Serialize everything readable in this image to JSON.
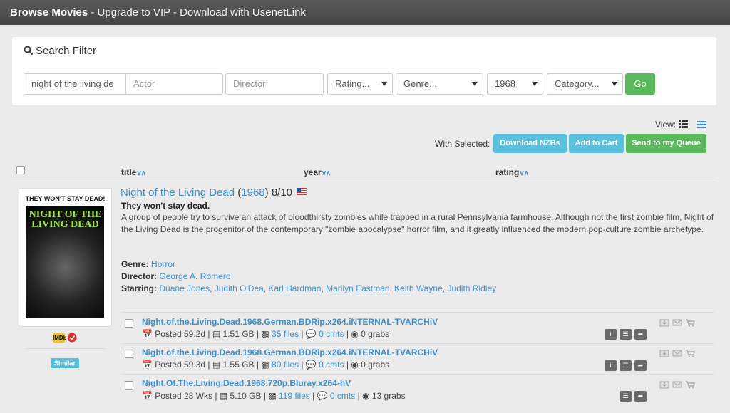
{
  "header": {
    "title": "Browse Movies",
    "subtitle": " - Upgrade to VIP - Download with UsenetLink"
  },
  "filter": {
    "title": "Search Filter",
    "title_value": "night of the living de",
    "actor_placeholder": "Actor",
    "director_placeholder": "Director",
    "rating": "Rating...",
    "genre": "Genre...",
    "year": "1968",
    "category": "Category...",
    "go_label": "Go"
  },
  "toolbar": {
    "view_label": "View:",
    "with_selected": "With Selected:",
    "download_nzbs": "Download NZBs",
    "add_to_cart": "Add to Cart",
    "send_to_queue": "Send to my Queue"
  },
  "columns": {
    "title": "title",
    "year": "year",
    "rating": "rating"
  },
  "movie": {
    "title": "Night of the Living Dead",
    "year": "1968",
    "rating": "8/10",
    "tagline": "They won't stay dead.",
    "plot": "A group of people try to survive an attack of bloodthirsty zombies while trapped in a rural Pennsylvania farmhouse. Although not the first zombie film, Night of the Living Dead is the progenitor of the contemporary \"zombie apocalypse\" horror film, and it greatly influenced the modern pop-culture zombie archetype.",
    "genre_label": "Genre:",
    "genre": "Horror",
    "director_label": "Director:",
    "director": "George A. Romero",
    "starring_label": "Starring:",
    "starring": [
      "Duane Jones",
      "Judith O'Dea",
      "Karl Hardman",
      "Marilyn Eastman",
      "Keith Wayne",
      "Judith Ridley"
    ],
    "poster_tagline": "THEY WON'T STAY DEAD!",
    "poster_title": "NIGHT OF THE LIVING DEAD",
    "imdb_label": "IMDb",
    "similar_label": "Similar"
  },
  "releases": [
    {
      "name": "Night.of.the.Living.Dead.1968.German.BDRip.x264.iNTERNAL-TVARCHiV",
      "posted": "Posted 59.2d",
      "size": "1.51 GB",
      "files": "35 files",
      "comments": "0 cmts",
      "grabs": "0 grabs",
      "has_info": true
    },
    {
      "name": "Night.of.the.Living.Dead.1968.German.BDRip.x264.iNTERNAL-TVARCHiV",
      "posted": "Posted 59.3d",
      "size": "1.55 GB",
      "files": "80 files",
      "comments": "0 cmts",
      "grabs": "0 grabs",
      "has_info": true
    },
    {
      "name": "Night.Of.The.Living.Dead.1968.720p.Bluray.x264-hV",
      "posted": "Posted 28 Wks",
      "size": "5.10 GB",
      "files": "119 files",
      "comments": "0 cmts",
      "grabs": "13 grabs",
      "has_info": false
    }
  ],
  "colors": {
    "link": "#3e8ecf",
    "success": "#5cb85c",
    "info": "#5bc0de"
  }
}
